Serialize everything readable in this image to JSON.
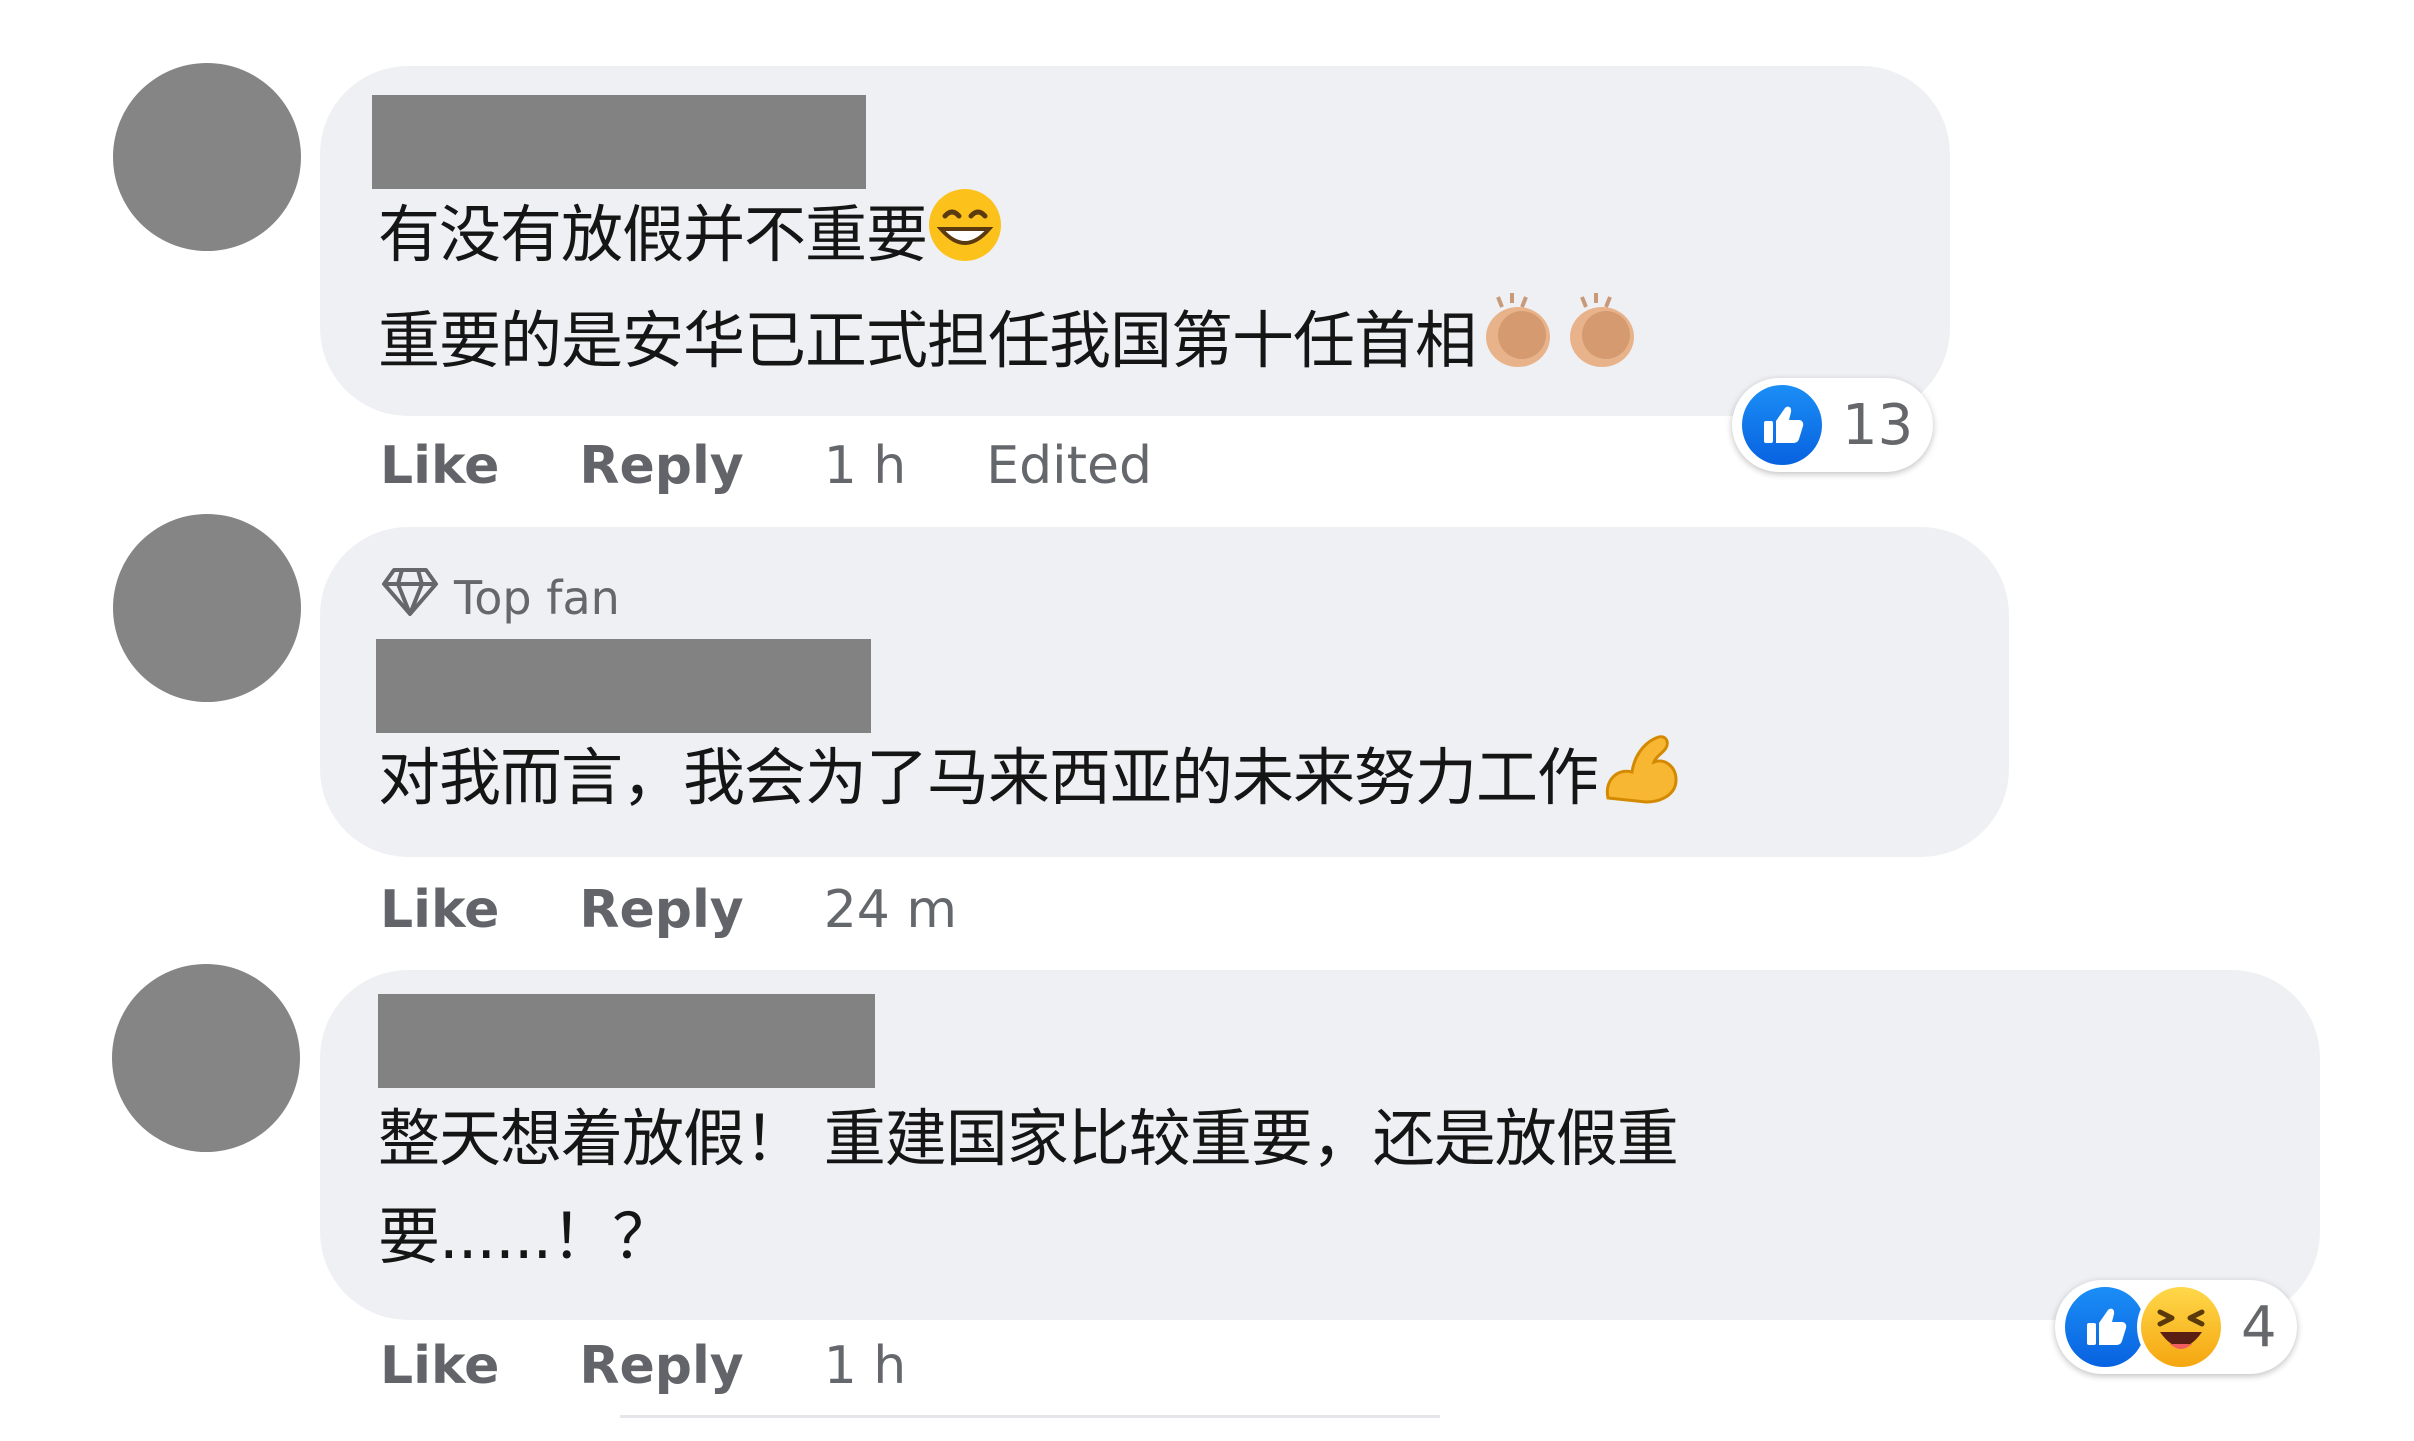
{
  "comments": [
    {
      "text_lines": [
        "有没有放假并不重要",
        "重要的是安华已正式担任我国第十任首相"
      ],
      "actions": {
        "like": "Like",
        "reply": "Reply",
        "time": "1 h",
        "edited": "Edited"
      },
      "reactions": {
        "types": [
          "like"
        ],
        "count": "13"
      }
    },
    {
      "badge": "Top fan",
      "text_lines": [
        "对我而言，我会为了马来西亚的未来努力工作"
      ],
      "actions": {
        "like": "Like",
        "reply": "Reply",
        "time": "24 m"
      }
    },
    {
      "text_lines": [
        "整天想着放假！ 重建国家比较重要，还是放假重",
        "要......！？"
      ],
      "actions": {
        "like": "Like",
        "reply": "Reply",
        "time": "1 h"
      },
      "reactions": {
        "types": [
          "like",
          "haha"
        ],
        "count": "4"
      }
    }
  ],
  "colors": {
    "bubble": "#eff0f4",
    "like_blue": "#1877f2",
    "muted": "#65676b",
    "redaction": "#828282"
  },
  "icons": [
    "diamond-icon",
    "like-reaction-icon",
    "haha-reaction-icon",
    "grinning-emoji-icon",
    "clap-emoji-icon",
    "flexed-biceps-emoji-icon"
  ]
}
